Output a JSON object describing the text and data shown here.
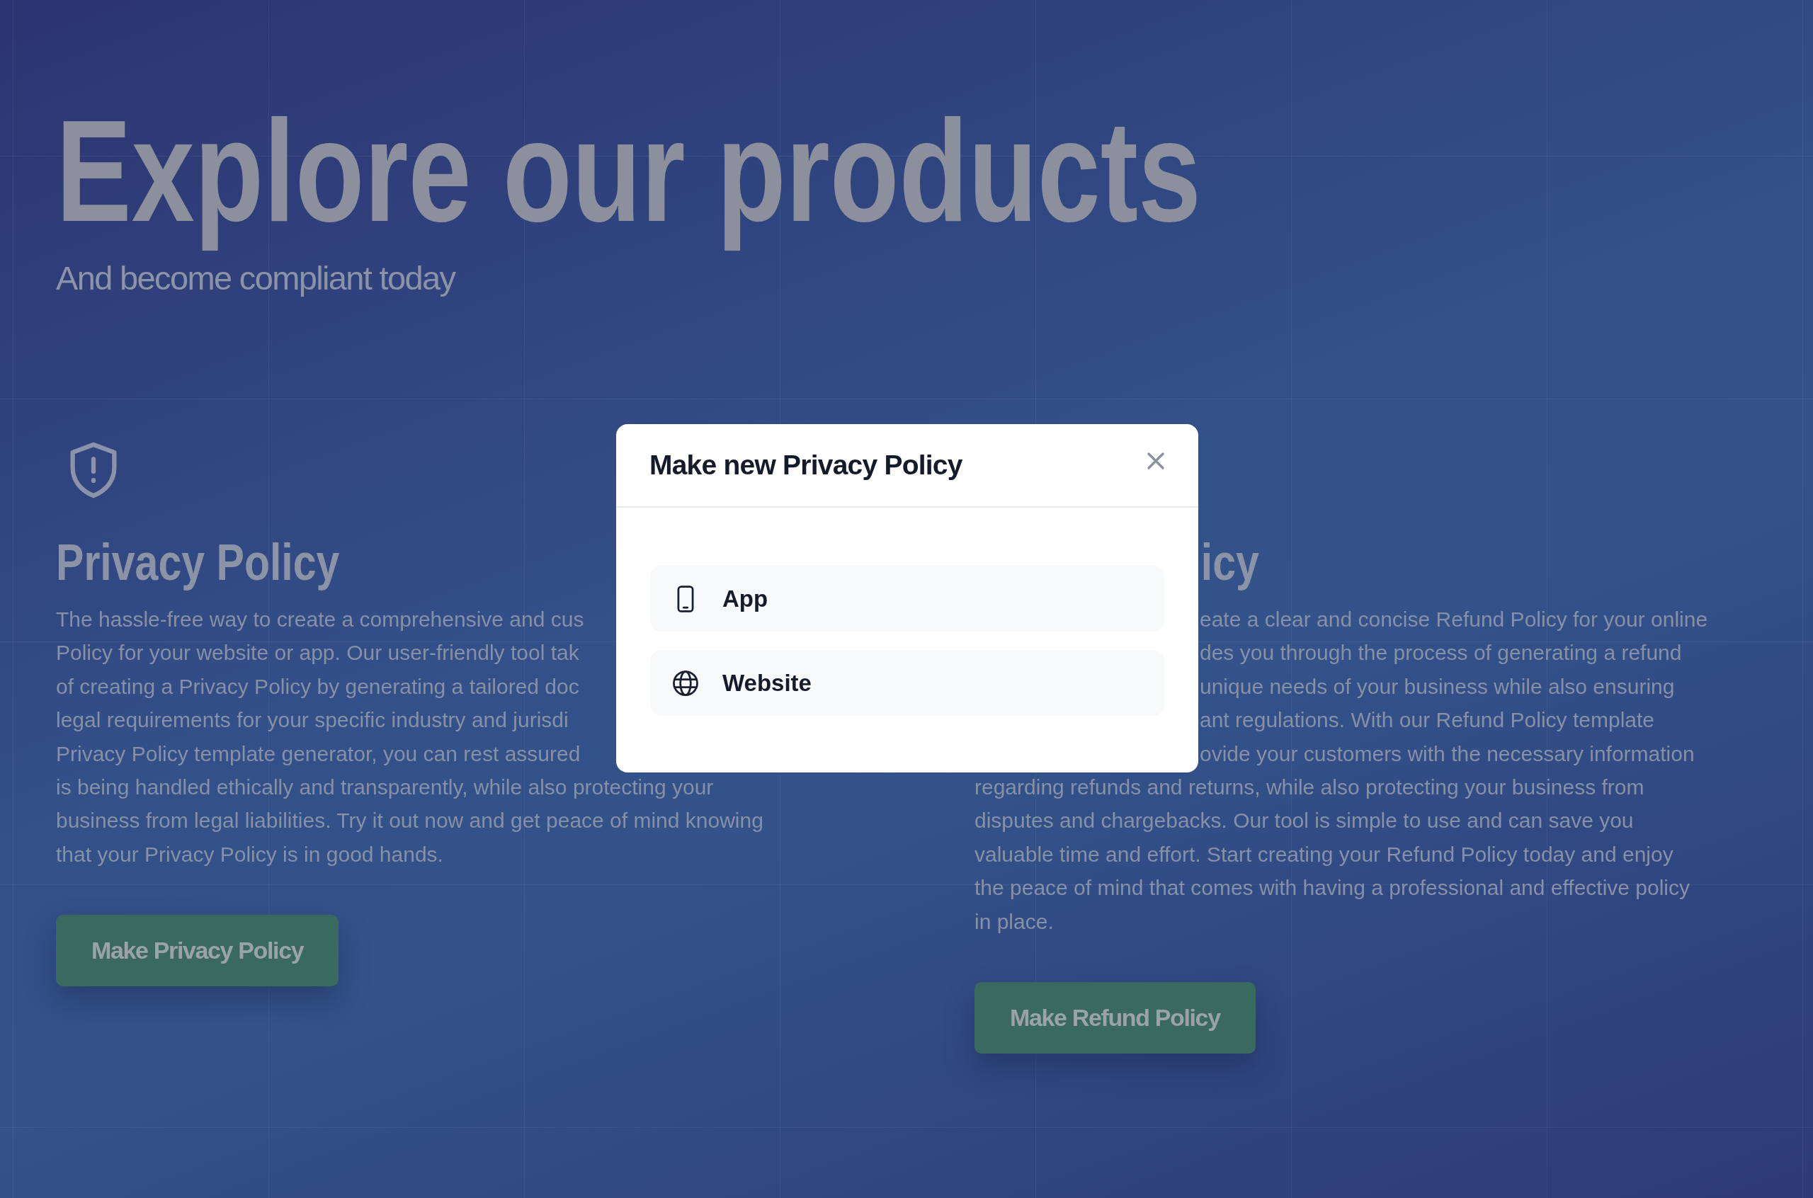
{
  "hero": {
    "title": "Explore our products",
    "subtitle": "And become compliant today"
  },
  "products": [
    {
      "icon": {
        "kind": "shield"
      },
      "heading": {
        "text": "Privacy Policy",
        "covered_start": false
      },
      "lines": [
        {
          "text": "The hassle-free way to create a comprehensive and cus",
          "covered_start": false
        },
        {
          "text": "Policy for your website or app. Our user-friendly tool tak",
          "covered_start": false
        },
        {
          "text": "of creating a Privacy Policy by generating a tailored doc",
          "covered_start": false
        },
        {
          "text": "legal requirements for your specific industry and jurisdi",
          "covered_start": false
        },
        {
          "text": "Privacy Policy template generator, you can rest assured",
          "covered_start": false
        },
        {
          "text": "is being handled ethically and transparently, while also protecting your",
          "covered_start": false
        },
        {
          "text": "business from legal liabilities. Try it out now and get peace of mind knowing",
          "covered_start": false
        },
        {
          "text": "that your Privacy Policy is in good hands.",
          "covered_start": false
        }
      ],
      "button": "Make Privacy Policy"
    },
    {
      "heading": {
        "text": "icy",
        "covered_start": true
      },
      "lines": [
        {
          "text": "eate a clear and concise Refund Policy for your online",
          "covered_start": true
        },
        {
          "text": "des you through the process of generating a refund",
          "covered_start": true
        },
        {
          "text": "unique needs of your business while also ensuring",
          "covered_start": true
        },
        {
          "text": "ant regulations. With our Refund Policy template",
          "covered_start": true
        },
        {
          "text": "ovide your customers with the necessary information",
          "covered_start": true
        },
        {
          "text": "regarding refunds and returns, while also protecting your business from",
          "covered_start": false
        },
        {
          "text": "disputes and chargebacks. Our tool is simple to use and can save you",
          "covered_start": false
        },
        {
          "text": "valuable time and effort. Start creating your Refund Policy today and enjoy",
          "covered_start": false
        },
        {
          "text": "the peace of mind that comes with having a professional and effective policy",
          "covered_start": false
        },
        {
          "text": "in place.",
          "covered_start": false
        }
      ],
      "button": "Make Refund Policy"
    }
  ],
  "modal": {
    "title": "Make new Privacy Policy",
    "options": [
      {
        "kind": "app",
        "label": "App"
      },
      {
        "kind": "website",
        "label": "Website"
      }
    ]
  }
}
